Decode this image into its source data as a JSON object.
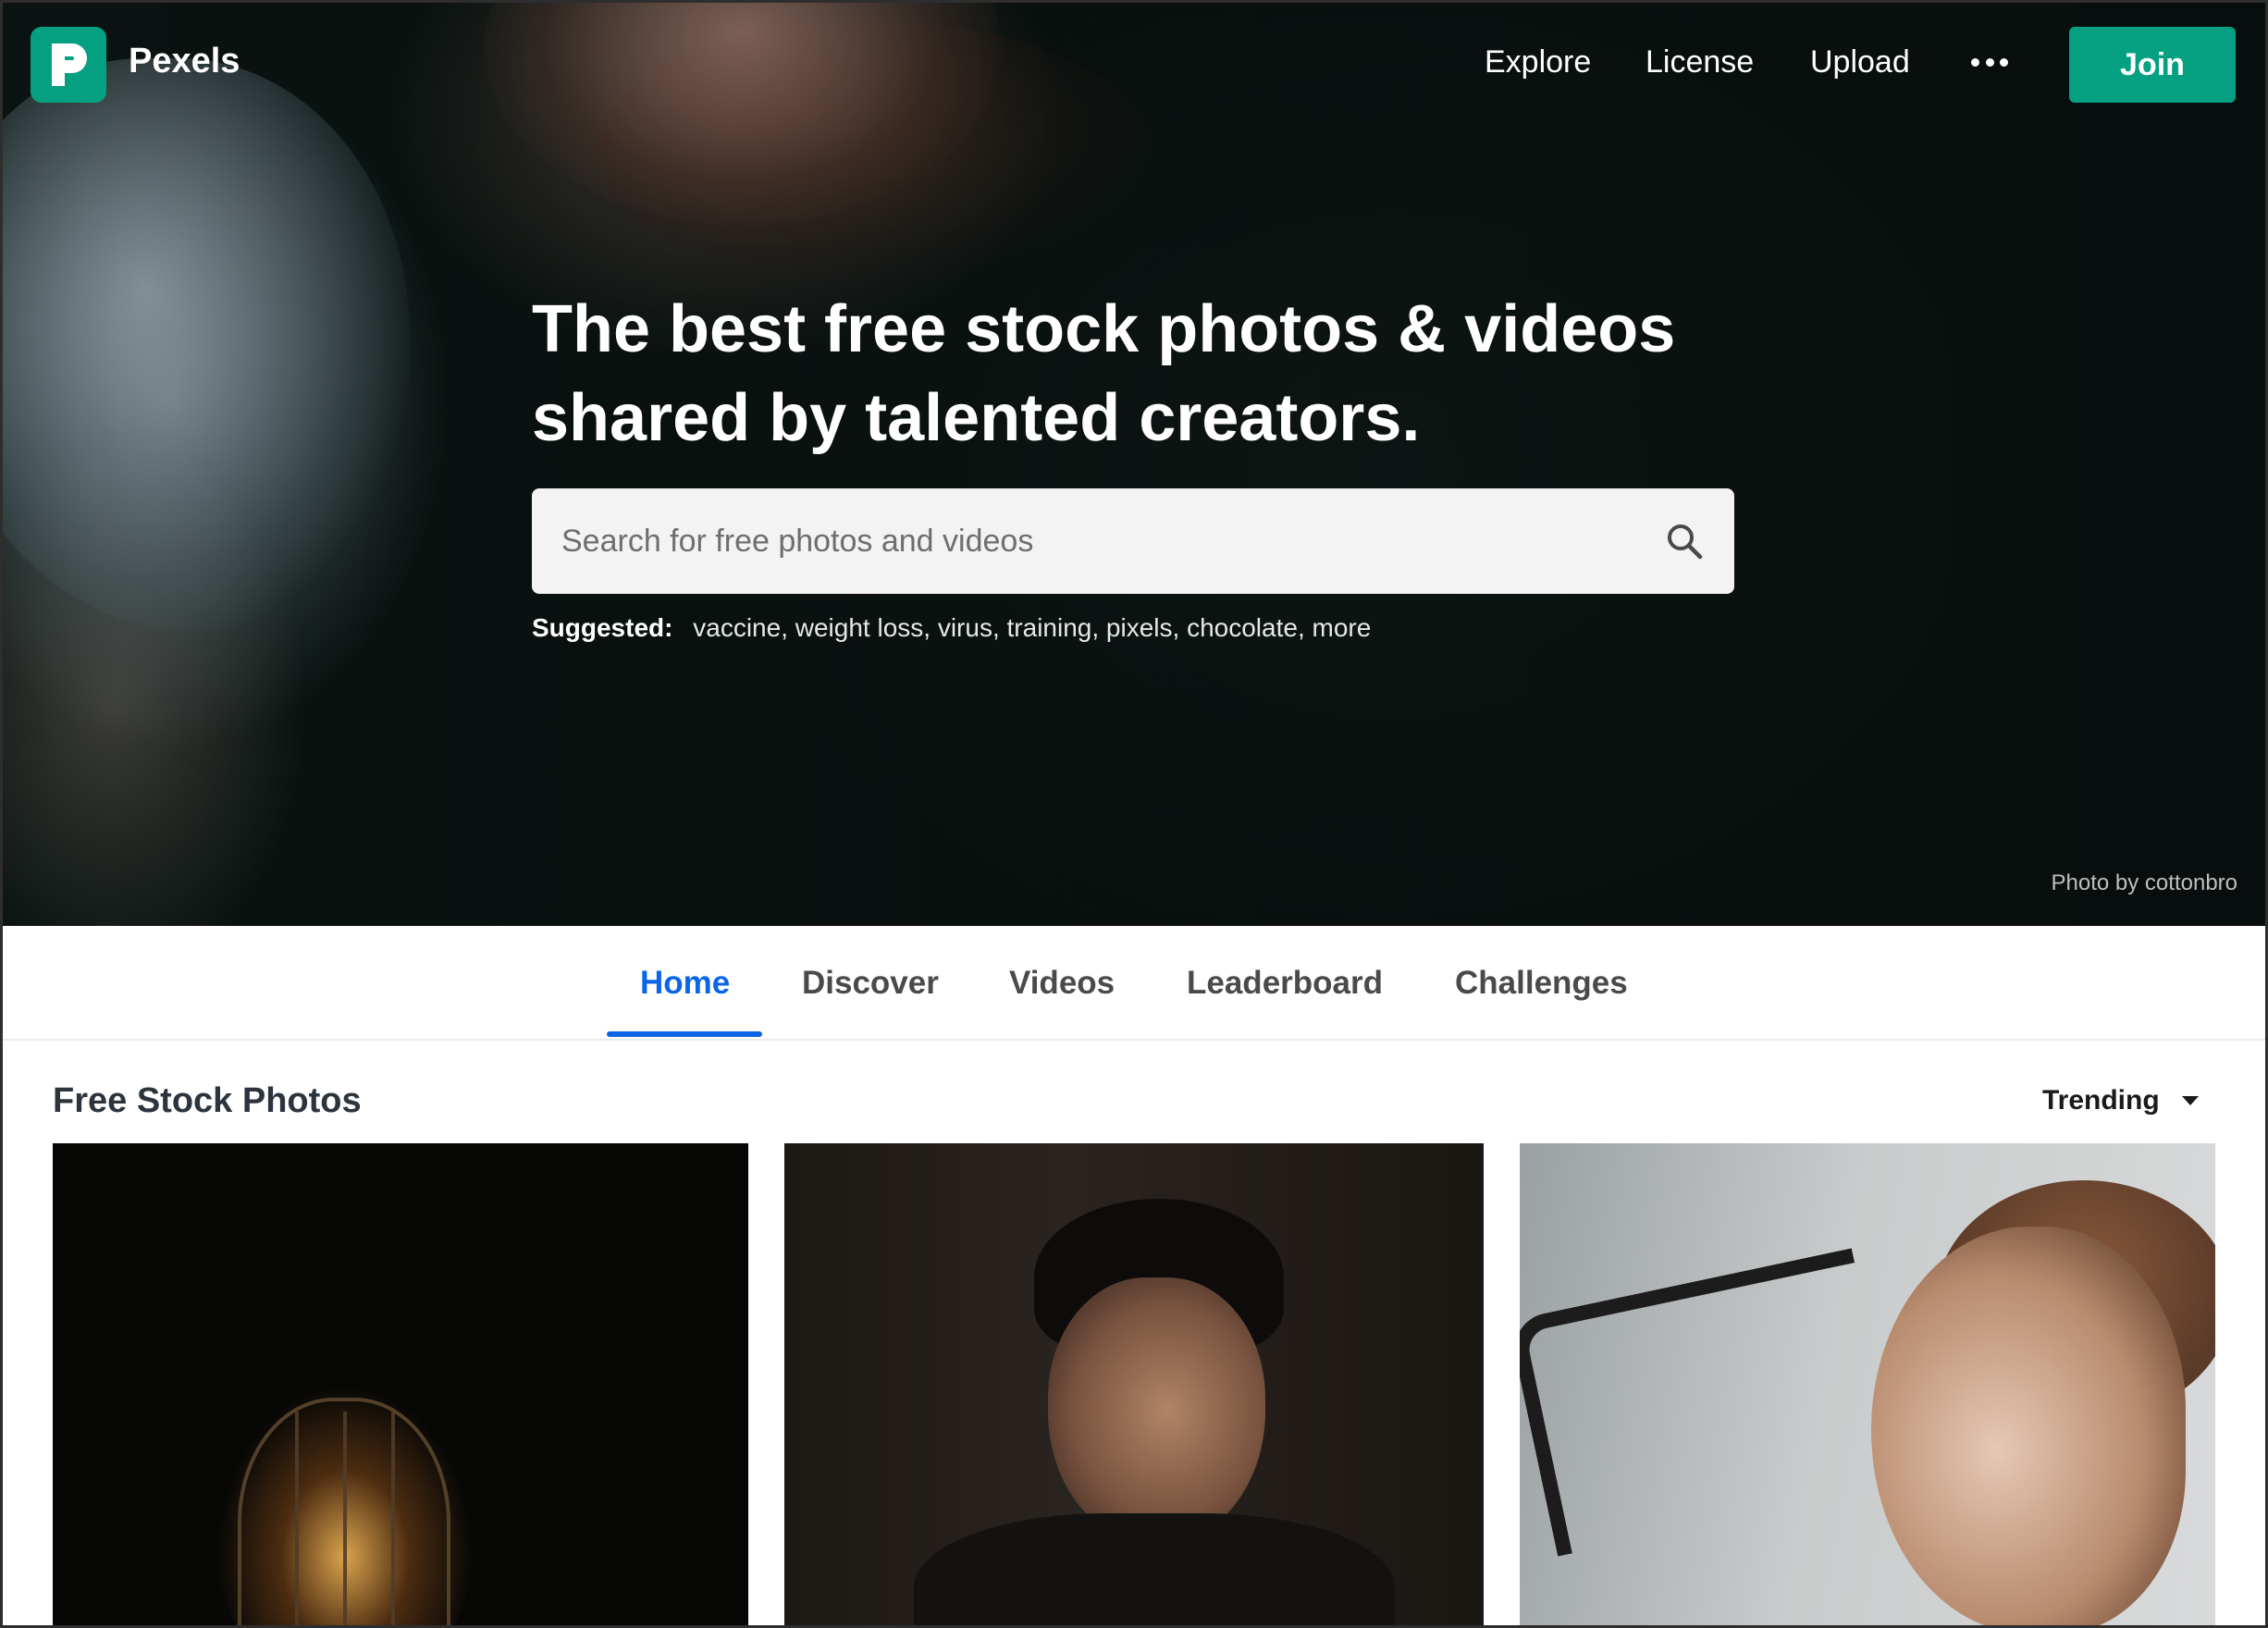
{
  "header": {
    "brand": "Pexels",
    "nav": {
      "explore": "Explore",
      "license": "License",
      "upload": "Upload"
    },
    "more_icon": "ellipsis-icon",
    "join_label": "Join"
  },
  "hero": {
    "headline_line1": "The best free stock photos & videos",
    "headline_line2": "shared by talented creators.",
    "search": {
      "placeholder": "Search for free photos and videos",
      "value": "",
      "icon": "search-icon"
    },
    "suggested": {
      "label": "Suggested:",
      "terms": [
        "vaccine",
        "weight loss",
        "virus",
        "training",
        "pixels",
        "chocolate",
        "more"
      ]
    },
    "credit": "Photo by cottonbro"
  },
  "tabs": {
    "items": [
      "Home",
      "Discover",
      "Videos",
      "Leaderboard",
      "Challenges"
    ],
    "active": "Home"
  },
  "section": {
    "title": "Free Stock Photos",
    "sort_label": "Trending"
  },
  "colors": {
    "brand": "#05a081",
    "active_tab": "#0a66e6"
  }
}
